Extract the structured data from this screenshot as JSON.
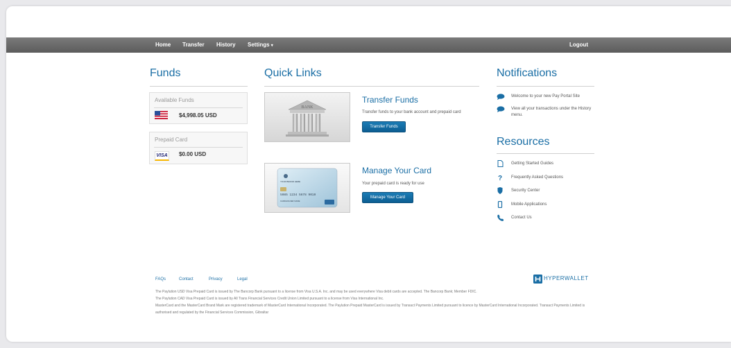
{
  "nav": {
    "home": "Home",
    "transfer": "Transfer",
    "history": "History",
    "settings": "Settings",
    "logout": "Logout"
  },
  "funds": {
    "heading": "Funds",
    "available_label": "Available Funds",
    "available_amount": "$4,998.05 USD",
    "prepaid_label": "Prepaid Card",
    "prepaid_amount": "$0.00 USD",
    "card_brand": "VISA"
  },
  "quick_links": {
    "heading": "Quick Links",
    "bank_sign": "BANK",
    "transfer": {
      "title": "Transfer Funds",
      "desc": "Transfer funds to your bank account and prepaid card",
      "button": "Transfer Funds"
    },
    "card_image": {
      "brand": "YOUR BRAND HERE",
      "number": "5085 1234 5678 9010",
      "holder": "CARDHOLDER NAME"
    },
    "manage": {
      "title": "Manage Your Card",
      "desc": "Your prepaid card is ready for use",
      "button": "Manage Your Card"
    }
  },
  "notifications": {
    "heading": "Notifications",
    "items": [
      "Welcome to your new Pay Portal Site",
      "View all your transactions under the History menu."
    ]
  },
  "resources": {
    "heading": "Resources",
    "items": [
      {
        "label": "Getting Started Guides",
        "icon": "document-icon"
      },
      {
        "label": "Frequently Asked Questions",
        "icon": "question-icon"
      },
      {
        "label": "Security Center",
        "icon": "shield-icon"
      },
      {
        "label": "Mobile Applications",
        "icon": "mobile-icon"
      },
      {
        "label": "Contact Us",
        "icon": "phone-icon"
      }
    ]
  },
  "footer": {
    "links": [
      "FAQs",
      "Contact",
      "Privacy",
      "Legal"
    ],
    "brand": "HYPERWALLET",
    "legal": [
      "The Paylution USD Visa Prepaid Card is issued by The Bancorp Bank pursuant to a license from Visa U.S.A. Inc. and may be used everywhere Visa debit cards are accepted. The Bancorp Bank; Member FDIC.",
      "The Paylution CAD Visa Prepaid Card is issued by All Trans Financial Services Credit Union Limited pursuant to a license from Visa International Inc.",
      "MasterCard and the MasterCard Brand Mark are registered trademark of MasterCard International Incorporated. The Paylution Prepaid MasterCard is issued by Transact Payments Limited pursuant to licence by MasterCard International Incorporated. Transact Payments Limited is authorised and regulated by the Financial Services Commission, Gibraltar"
    ]
  },
  "colors": {
    "accent": "#1a6ea5",
    "nav_bar": "#666666",
    "button": "#0d5e92"
  }
}
